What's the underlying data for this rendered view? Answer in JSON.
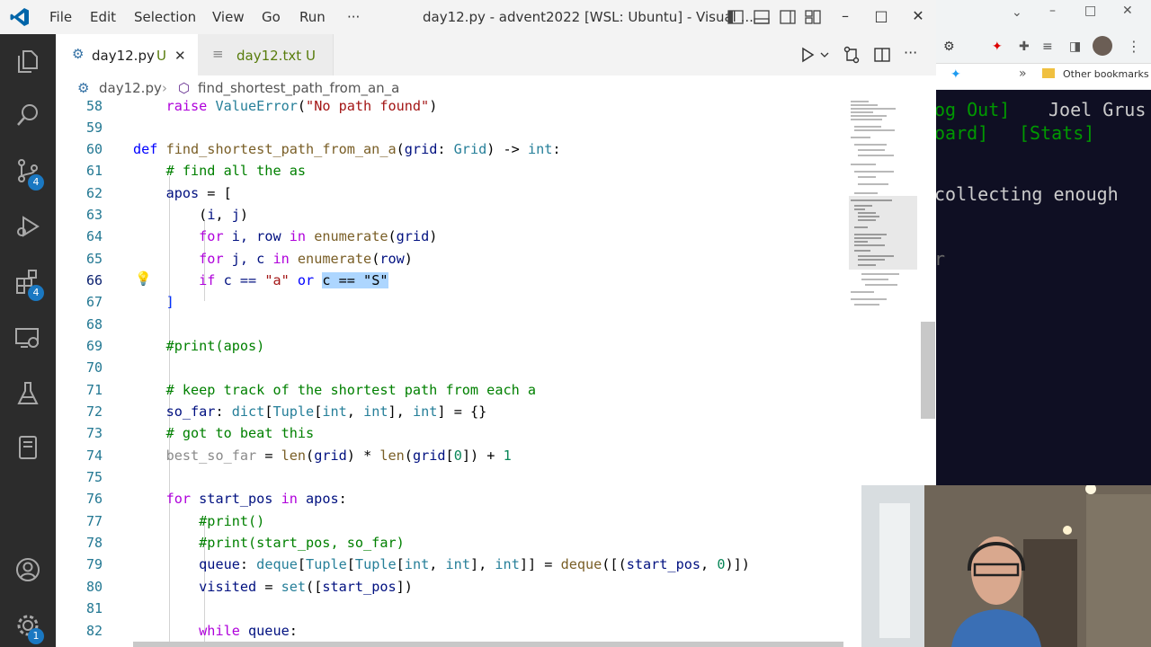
{
  "window": {
    "menu": [
      "File",
      "Edit",
      "Selection",
      "View",
      "Go",
      "Run",
      "···"
    ],
    "title": "day12.py - advent2022 [WSL: Ubuntu] - Visual ...",
    "controls": {
      "minimize": "–",
      "maximize": "□",
      "close": "✕"
    }
  },
  "activity_bar": {
    "badges": {
      "source_control": "4",
      "extensions": "4",
      "settings": "1"
    }
  },
  "tabs": [
    {
      "label": "day12.py",
      "status": "U",
      "close": "✕"
    },
    {
      "label": "day12.txt",
      "status": "U"
    }
  ],
  "breadcrumb": {
    "file": "day12.py",
    "symbol": "find_shortest_path_from_an_a"
  },
  "editor": {
    "line_numbers": [
      "58",
      "59",
      "60",
      "61",
      "62",
      "63",
      "64",
      "65",
      "66",
      "67",
      "68",
      "69",
      "70",
      "71",
      "72",
      "73",
      "74",
      "75",
      "76",
      "77",
      "78",
      "79",
      "80",
      "81",
      "82"
    ],
    "current_line": "66",
    "code": {
      "l58": {
        "kw": "raise",
        "cls": "ValueError",
        "open": "(",
        "str": "\"No path found\"",
        "close": ")"
      },
      "l60": {
        "kw": "def",
        "fn": "find_shortest_path_from_an_a",
        "p1": "(",
        "arg": "grid",
        "colon": ": ",
        "type": "Grid",
        "arrow": ") -> ",
        "ret": "int",
        "end": ":"
      },
      "l61": "# find all the as",
      "l62": {
        "var": "apos",
        "rest": " = ["
      },
      "l63": {
        "p": "(",
        "i": "i",
        "c": ", ",
        "j": "j",
        "e": ")"
      },
      "l64": {
        "kw": "for",
        "a": " i, ",
        "b": "row",
        "in": " in ",
        "fn": "enumerate",
        "o": "(",
        "g": "grid",
        "e": ")"
      },
      "l65": {
        "kw": "for",
        "a": " j, ",
        "b": "c",
        "in": " in ",
        "fn": "enumerate",
        "o": "(",
        "g": "row",
        "e": ")"
      },
      "l66": {
        "kw": "if",
        "a": " c == ",
        "s1": "\"a\"",
        "or": " or ",
        "sel": "c == \"S\""
      },
      "l67": "]",
      "l69": "#print(apos)",
      "l71": "# keep track of the shortest path from each a",
      "l72": {
        "var": "so_far",
        "c": ": ",
        "t1": "dict",
        "b1": "[",
        "t2": "Tuple",
        "b2": "[",
        "t3": "int",
        "cm": ", ",
        "t4": "int",
        "b3": "], ",
        "t5": "int",
        "rest": "] = {}"
      },
      "l73": "# got to beat this",
      "l74": {
        "dim": "best_so_far",
        "eq": " = ",
        "fn1": "len",
        "o1": "(",
        "g1": "grid",
        "m": ") * ",
        "fn2": "len",
        "o2": "(",
        "g2": "grid",
        "i": "[",
        "n0": "0",
        "r": "]) + ",
        "n1": "1"
      },
      "l76": {
        "kw": "for",
        "v": " start_pos",
        "in": " in ",
        "a": "apos",
        "e": ":"
      },
      "l77": "#print()",
      "l78": "#print(start_pos, so_far)",
      "l79": {
        "var": "queue",
        "c": ": ",
        "t1": "deque",
        "b1": "[",
        "t2": "Tuple",
        "b2": "[",
        "t3": "Tuple",
        "b3": "[",
        "t4": "int",
        "cm": ", ",
        "t5": "int",
        "b4": "], ",
        "t6": "int",
        "b5": "]] = ",
        "fn": "deque",
        "o": "([(",
        "v": "start_pos",
        "cm2": ", ",
        "n": "0",
        "e": ")])"
      },
      "l80": {
        "var": "visited",
        "eq": " = ",
        "fn": "set",
        "o": "([",
        "v": "start_pos",
        "e": "])"
      },
      "l82": {
        "kw": "while",
        "v": " queue",
        "e": ":"
      }
    }
  },
  "browser": {
    "bookmarks": "Other bookmarks",
    "chevron": "»"
  },
  "terminal": {
    "line1_a": "og Out]",
    "line1_b": "Joel Grus",
    "line2_a": "oard]",
    "line2_b": "[Stats]",
    "line3": "collecting enough",
    "line4": "r"
  },
  "colors": {
    "accent": "#1a78c2",
    "selection": "#add6ff",
    "terminal_link": "#009900"
  }
}
